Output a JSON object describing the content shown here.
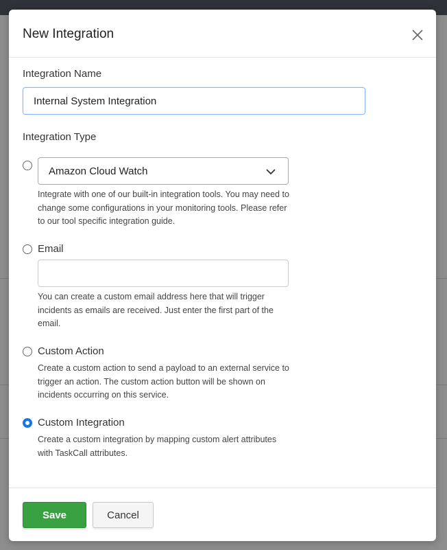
{
  "modal": {
    "title": "New Integration",
    "close_icon": "close-icon"
  },
  "integration_name": {
    "label": "Integration Name",
    "value": "Internal System Integration"
  },
  "integration_type": {
    "label": "Integration Type",
    "options": [
      {
        "kind": "select",
        "selected": false,
        "select_value": "Amazon Cloud Watch",
        "help": "Integrate with one of our built-in integration tools. You may need to change some configurations in your monitoring tools. Please refer to our tool specific integration guide."
      },
      {
        "kind": "email",
        "selected": false,
        "label": "Email",
        "input_value": "",
        "help": "You can create a custom email address here that will trigger incidents as emails are received. Just enter the first part of the email."
      },
      {
        "kind": "custom_action",
        "selected": false,
        "label": "Custom Action",
        "help": "Create a custom action to send a payload to an external service to trigger an action. The custom action button will be shown on incidents occurring on this service."
      },
      {
        "kind": "custom_integration",
        "selected": true,
        "label": "Custom Integration",
        "help": "Create a custom integration by mapping custom alert attributes with TaskCall attributes."
      }
    ]
  },
  "footer": {
    "save_label": "Save",
    "cancel_label": "Cancel"
  },
  "colors": {
    "accent": "#1a73e8",
    "save": "#3aa142"
  }
}
